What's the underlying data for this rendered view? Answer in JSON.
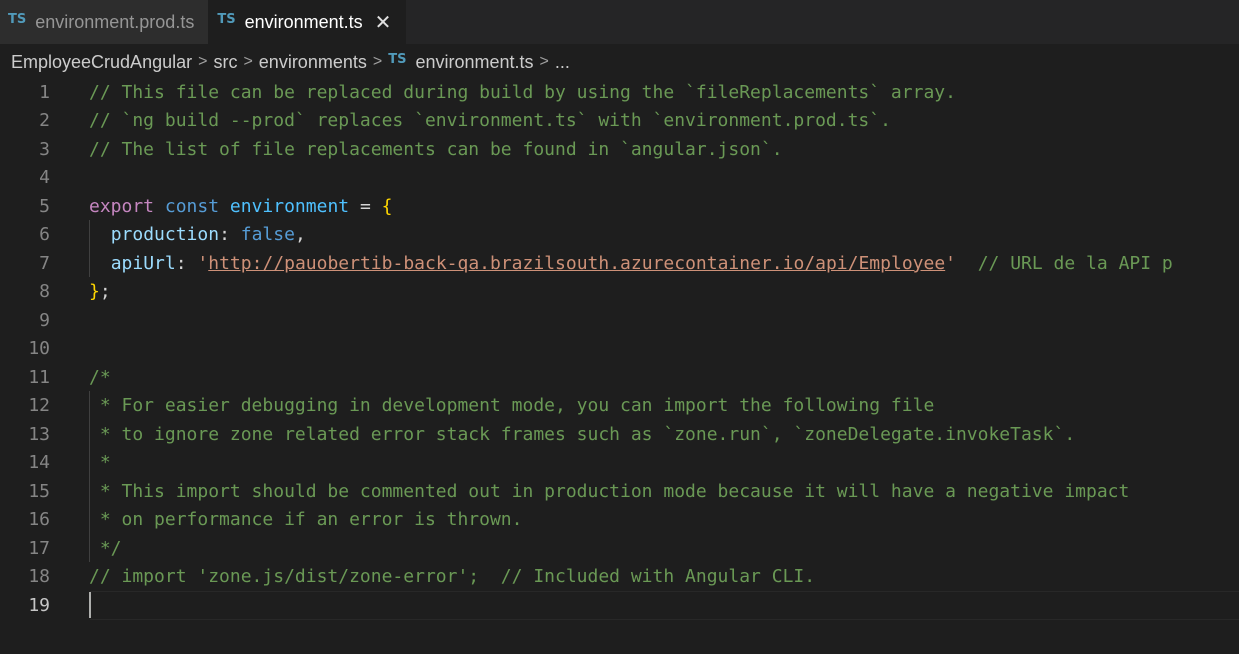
{
  "tabs": [
    {
      "icon_text": "TS",
      "label": "environment.prod.ts",
      "active": false
    },
    {
      "icon_text": "TS",
      "label": "environment.ts",
      "active": true,
      "close": "✕"
    }
  ],
  "breadcrumb": {
    "items": [
      "EmployeeCrudAngular",
      "src",
      "environments"
    ],
    "file_icon": "TS",
    "file": "environment.ts",
    "more": "..."
  },
  "editor": {
    "line_numbers": [
      "1",
      "2",
      "3",
      "4",
      "5",
      "6",
      "7",
      "8",
      "9",
      "10",
      "11",
      "12",
      "13",
      "14",
      "15",
      "16",
      "17",
      "18",
      "19"
    ],
    "current_line": "19",
    "lines": {
      "l1": "// This file can be replaced during build by using the `fileReplacements` array.",
      "l2": "// `ng build --prod` replaces `environment.ts` with `environment.prod.ts`.",
      "l3": "// The list of file replacements can be found in `angular.json`.",
      "l5_kw": "export",
      "l5_const": "const",
      "l5_name": "environment",
      "l5_eq": " = ",
      "l5_brace": "{",
      "l6_prop": "production",
      "l6_colon": ": ",
      "l6_val": "false",
      "l6_comma": ",",
      "l7_prop": "apiUrl",
      "l7_colon": ": ",
      "l7_q1": "'",
      "l7_url": "http://pauobertib-back-qa.brazilsouth.azurecontainer.io/api/Employee",
      "l7_q2": "'",
      "l7_comment": "  // URL de la API p",
      "l8_brace": "}",
      "l8_semi": ";",
      "l11": "/*",
      "l12": " * For easier debugging in development mode, you can import the following file",
      "l13": " * to ignore zone related error stack frames such as `zone.run`, `zoneDelegate.invokeTask`.",
      "l14": " *",
      "l15": " * This import should be commented out in production mode because it will have a negative impact",
      "l16": " * on performance if an error is thrown.",
      "l17": " */",
      "l18": "// import 'zone.js/dist/zone-error';  // Included with Angular CLI."
    }
  },
  "colors": {
    "background": "#1e1e1e",
    "comment": "#6a9955",
    "keyword": "#c586c0",
    "storage": "#569cd6",
    "string": "#ce9178",
    "property": "#9cdcfe",
    "brace": "#ffd700",
    "ts_icon": "#519aba"
  }
}
